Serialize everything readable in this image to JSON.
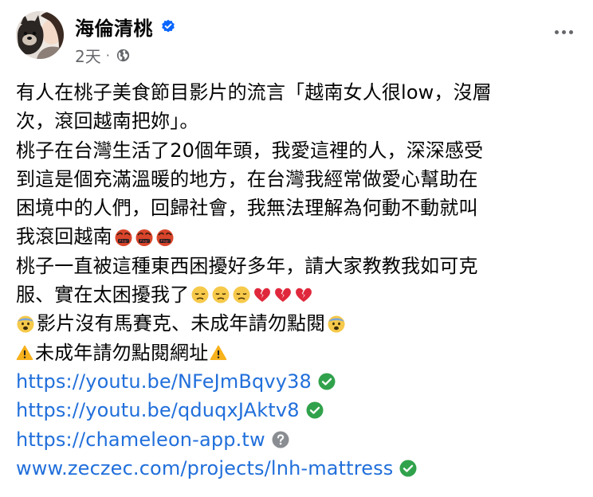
{
  "post": {
    "author": "海倫清桃",
    "time": "2天",
    "meta_dot": "·",
    "icons": {
      "verified": "verified-badge-icon",
      "audience": "globe-icon",
      "more": "more-options-icon"
    },
    "colors": {
      "verified": "#0866ff",
      "link": "#216fdb",
      "safe_link": "#31a24c",
      "unknown_link": "#8a8d91",
      "secondary_text": "#65676b"
    },
    "lines": [
      "有人在桃子美食節目影片的流言「越南女人很low，沒層",
      "次，滾回越南把妳」。",
      "桃子在台灣生活了20個年頭，我愛這裡的人，深深感受",
      "到這是個充滿溫暖的地方，在台灣我經常做愛心幫助在",
      "困境中的人們，回歸社會，我無法理解為何動不動就叫",
      "我滾回越南",
      "桃子一直被這種東西困擾好多年，請大家教教我如可克",
      "服、實在太困擾我了",
      "影片沒有馬賽克、未成年請勿點閱",
      "未成年請勿點閱網址"
    ],
    "links": [
      {
        "text": "https://youtu.be/NFeJmBqvy38",
        "status": "safe"
      },
      {
        "text": "https://youtu.be/qduqxJAktv8",
        "status": "safe"
      },
      {
        "text": "https://chameleon-app.tw",
        "status": "unknown"
      },
      {
        "text": "www.zeczec.com/projects/lnh-mattress",
        "status": "safe"
      }
    ]
  }
}
